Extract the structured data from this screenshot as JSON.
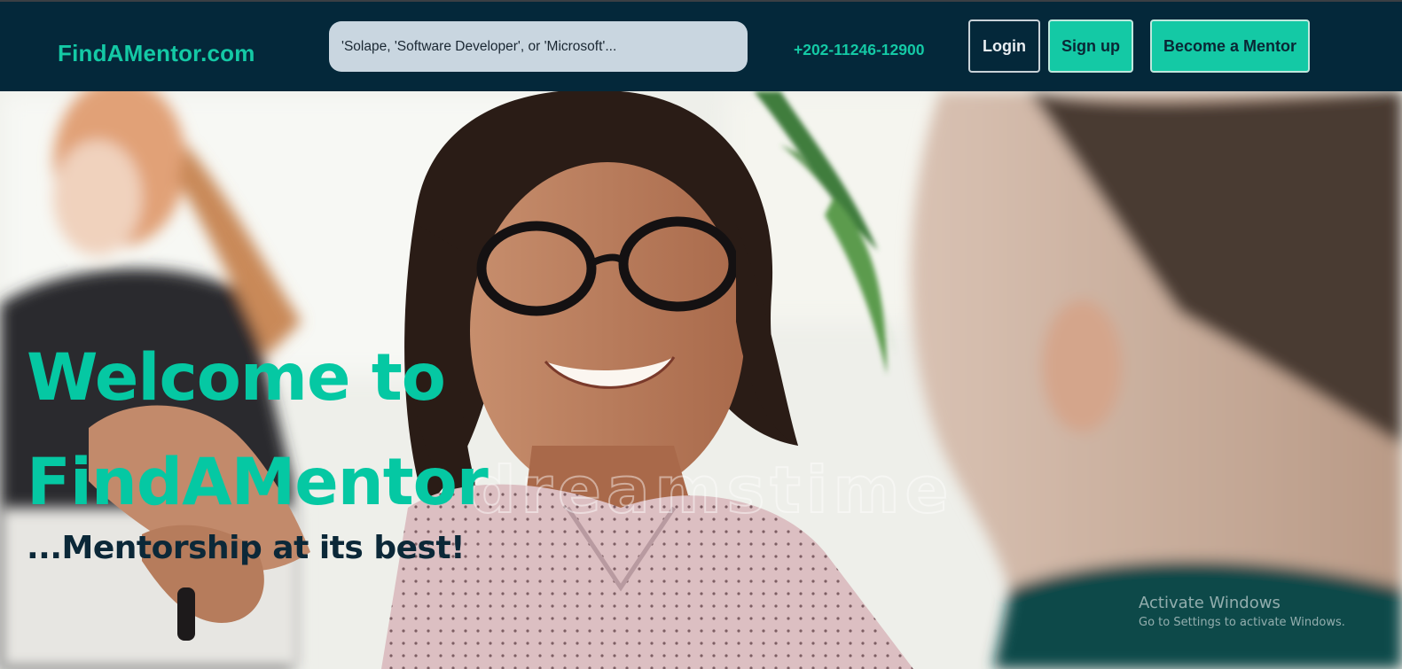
{
  "navbar": {
    "brand": "FindAMentor.com",
    "search_placeholder": "'Solape, 'Software Developer', or 'Microsoft'...",
    "phone": "+202-11246-12900",
    "login_label": "Login",
    "signup_label": "Sign up",
    "become_mentor_label": "Become a Mentor"
  },
  "hero": {
    "headline": "Welcome to FindAMentor",
    "tagline": "...Mentorship at its best!",
    "watermark": "dreamstime"
  },
  "system_overlay": {
    "activate_title": "Activate Windows",
    "activate_subtitle": "Go to Settings to activate Windows."
  },
  "colors": {
    "navbar_bg": "#04283a",
    "accent": "#14c9a5",
    "search_bg": "#c9d6e0",
    "tagline": "#0b2838"
  }
}
